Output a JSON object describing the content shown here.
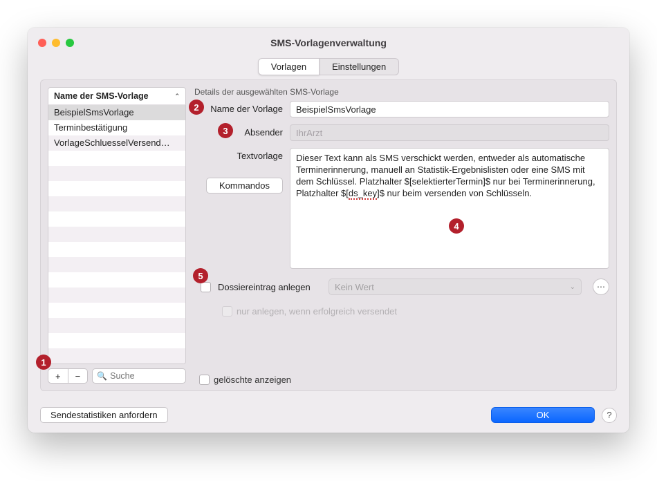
{
  "window_title": "SMS-Vorlagenverwaltung",
  "tabs": {
    "vorlagen": "Vorlagen",
    "einstellungen": "Einstellungen"
  },
  "list": {
    "header": "Name der SMS-Vorlage",
    "items": [
      "BeispielSmsVorlage",
      "Terminbestätigung",
      "VorlageSchluesselVersend…"
    ],
    "selected_index": 0
  },
  "list_toolbar": {
    "add": "+",
    "remove": "−",
    "search_placeholder": "Suche"
  },
  "deleted_checkbox": "gelöschte anzeigen",
  "details": {
    "section_title": "Details der ausgewählten SMS-Vorlage",
    "labels": {
      "name": "Name der Vorlage",
      "absender": "Absender",
      "textvorlage": "Textvorlage",
      "kommandos": "Kommandos",
      "dossier": "Dossiereintrag anlegen",
      "sub": "nur anlegen, wenn erfolgreich versendet"
    },
    "values": {
      "name": "BeispielSmsVorlage",
      "absender_placeholder": "IhrArzt",
      "text_pre": "Dieser Text kann als SMS verschickt werden, entweder als automatische Terminerinnerung, manuell an Statistik-Ergebnislisten oder eine SMS mit dem Schlüssel. Platzhalter $[selektierterTermin]$ nur bei Terminerinnerung, Platzhalter $[",
      "text_underlined": "ds_key",
      "text_post": "]$ nur beim versenden von Schlüsseln."
    },
    "dropdown_placeholder": "Kein Wert",
    "more_btn": "⋯"
  },
  "footer": {
    "stats": "Sendestatistiken anfordern",
    "ok": "OK",
    "help": "?"
  },
  "callouts": {
    "c1": "1",
    "c2": "2",
    "c3": "3",
    "c4": "4",
    "c5": "5"
  }
}
